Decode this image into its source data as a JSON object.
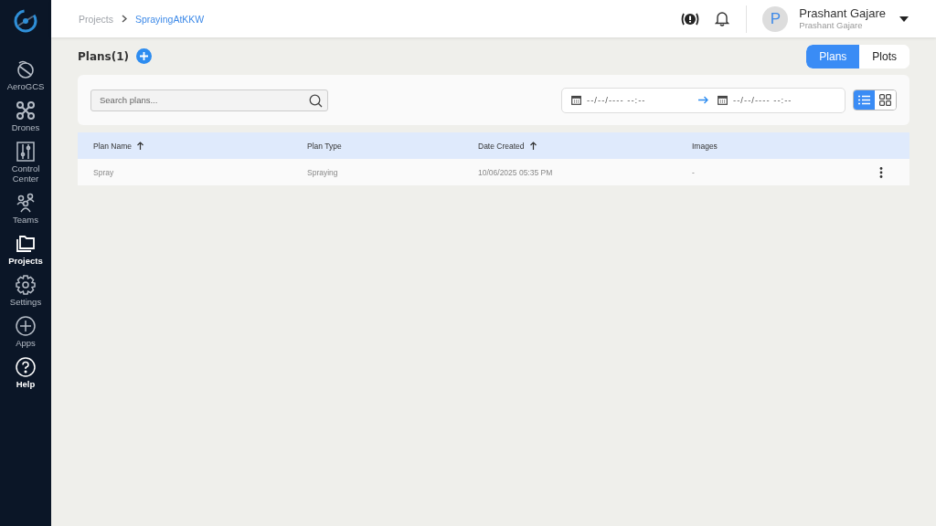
{
  "sidebar": {
    "items": [
      {
        "label": "AeroGCS",
        "kind": "aerogcs",
        "selected": false
      },
      {
        "label": "Drones",
        "kind": "drone",
        "selected": false
      },
      {
        "label": "Control Center",
        "kind": "control",
        "selected": false
      },
      {
        "label": "Teams",
        "kind": "teams",
        "selected": false
      },
      {
        "label": "Projects",
        "kind": "folder",
        "selected": true
      },
      {
        "label": "Settings",
        "kind": "gear",
        "selected": false
      },
      {
        "label": "Apps",
        "kind": "plus",
        "selected": false
      },
      {
        "label": "Help",
        "kind": "help",
        "selected": true
      }
    ]
  },
  "breadcrumb": [
    {
      "label": "Projects",
      "current": false
    },
    {
      "label": "SprayingAtKKW",
      "current": true
    }
  ],
  "user": {
    "initial": "P",
    "name": "Prashant Gajare",
    "subtitle": "Prashant Gajare"
  },
  "heading": "Plans(1)",
  "view_tabs": [
    {
      "label": "Plans",
      "selected": true
    },
    {
      "label": "Plots",
      "selected": false
    }
  ],
  "search": {
    "placeholder": "Search plans..."
  },
  "date_range": {
    "start_placeholder": "--/--/---- --:--",
    "end_placeholder": "--/--/---- --:--"
  },
  "layout_toggle": [
    {
      "kind": "list",
      "selected": true
    },
    {
      "kind": "grid",
      "selected": false
    }
  ],
  "table": {
    "columns": [
      {
        "label": "Plan Name",
        "sorted": true
      },
      {
        "label": "Plan Type",
        "sorted": false
      },
      {
        "label": "Date Created",
        "sorted": true
      },
      {
        "label": "Images",
        "sorted": false
      }
    ],
    "rows": [
      {
        "cells": [
          "Spray",
          "Spraying",
          "10/06/2025 05:35 PM",
          "-"
        ]
      }
    ]
  }
}
